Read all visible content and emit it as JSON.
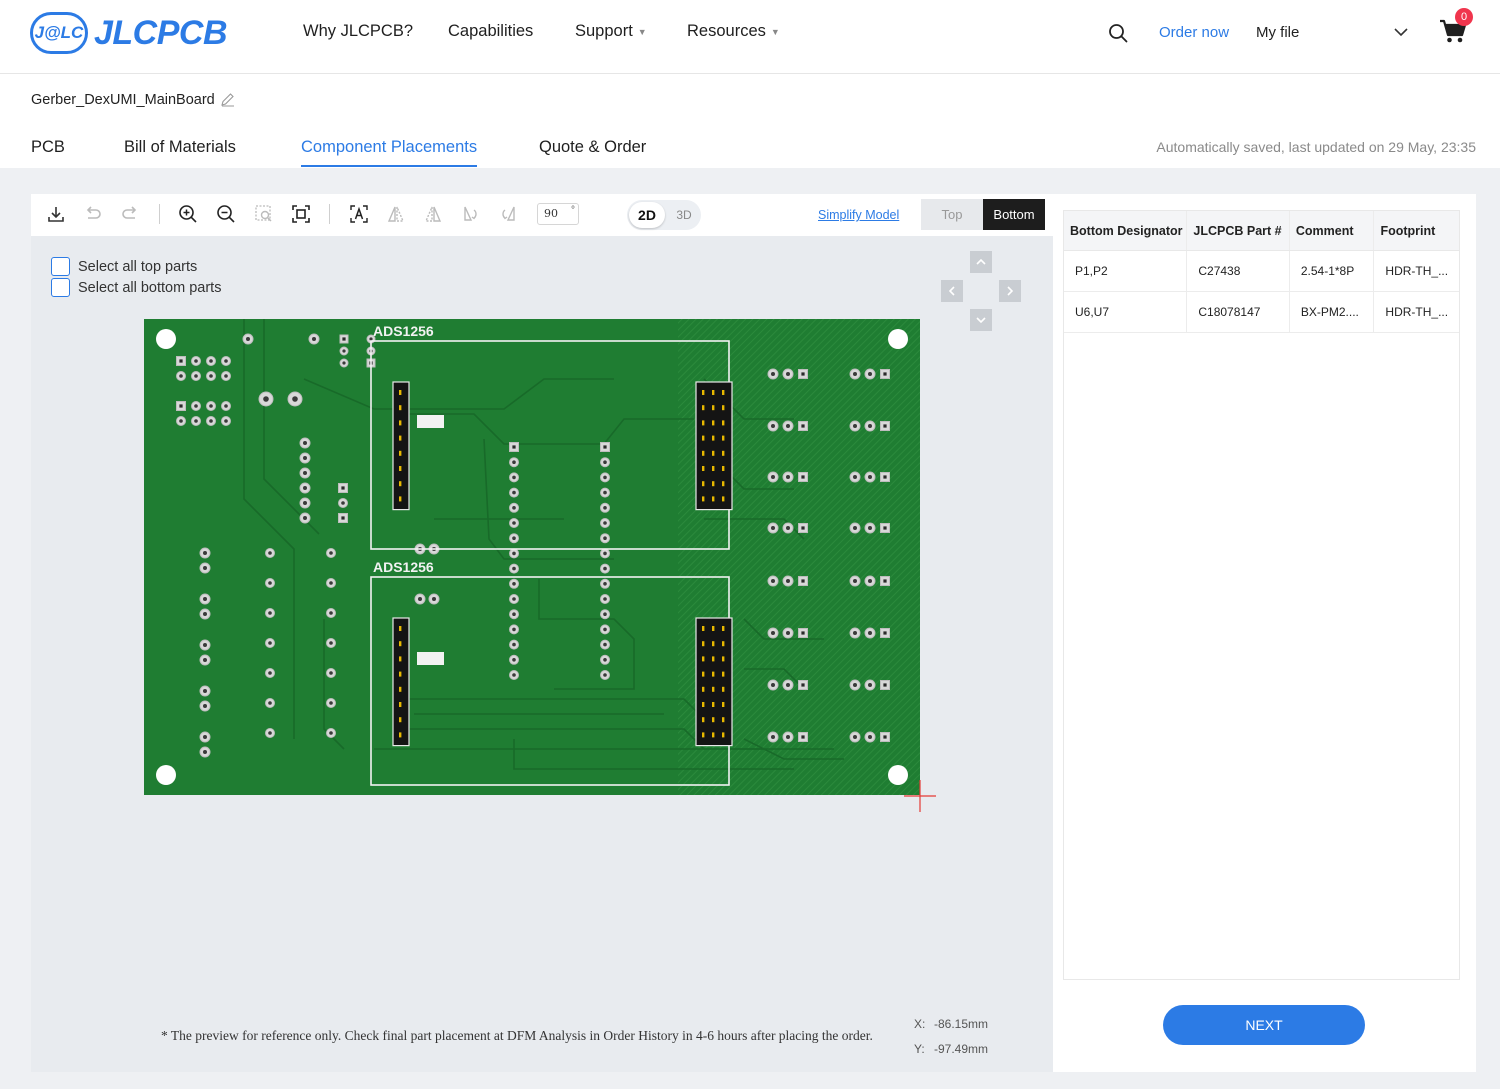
{
  "brand": {
    "mark": "J@LC",
    "name": "JLCPCB",
    "color": "#2c7be5"
  },
  "nav": {
    "items": [
      {
        "label": "Why JLCPCB?",
        "dropdown": false
      },
      {
        "label": "Capabilities",
        "dropdown": false
      },
      {
        "label": "Support",
        "dropdown": true
      },
      {
        "label": "Resources",
        "dropdown": true
      }
    ],
    "order_now": "Order now",
    "my_file": "My file",
    "cart_count": "0"
  },
  "project": {
    "file_name": "Gerber_DexUMI_MainBoard",
    "tabs": [
      {
        "label": "PCB",
        "active": false
      },
      {
        "label": "Bill of Materials",
        "active": false
      },
      {
        "label": "Component Placements",
        "active": true
      },
      {
        "label": "Quote & Order",
        "active": false
      }
    ],
    "autosave": "Automatically saved, last updated on 29 May, 23:35"
  },
  "viewer": {
    "rotation": "90",
    "rotation_unit": "°",
    "view_2d": "2D",
    "view_3d": "3D",
    "simplify_model": "Simplify Model",
    "side_top": "Top",
    "side_bottom": "Bottom",
    "select_top": "Select all top parts",
    "select_bottom": "Select all bottom parts",
    "board_labels": [
      "ADS1256",
      "ADS1256"
    ],
    "pcb_color": "#1f7d32",
    "note": "* The preview for reference only. Check final part placement at DFM Analysis in Order History in 4-6 hours after placing the order.",
    "x_label": "X:",
    "x_value": "-86.15mm",
    "y_label": "Y:",
    "y_value": "-97.49mm"
  },
  "bom": {
    "headers": [
      "Bottom Designator",
      "JLCPCB Part #",
      "Comment",
      "Footprint"
    ],
    "rows": [
      [
        "P1,P2",
        "C27438",
        "2.54-1*8P",
        "HDR-TH_..."
      ],
      [
        "U6,U7",
        "C18078147",
        "BX-PM2....",
        "HDR-TH_..."
      ]
    ],
    "next": "NEXT"
  }
}
